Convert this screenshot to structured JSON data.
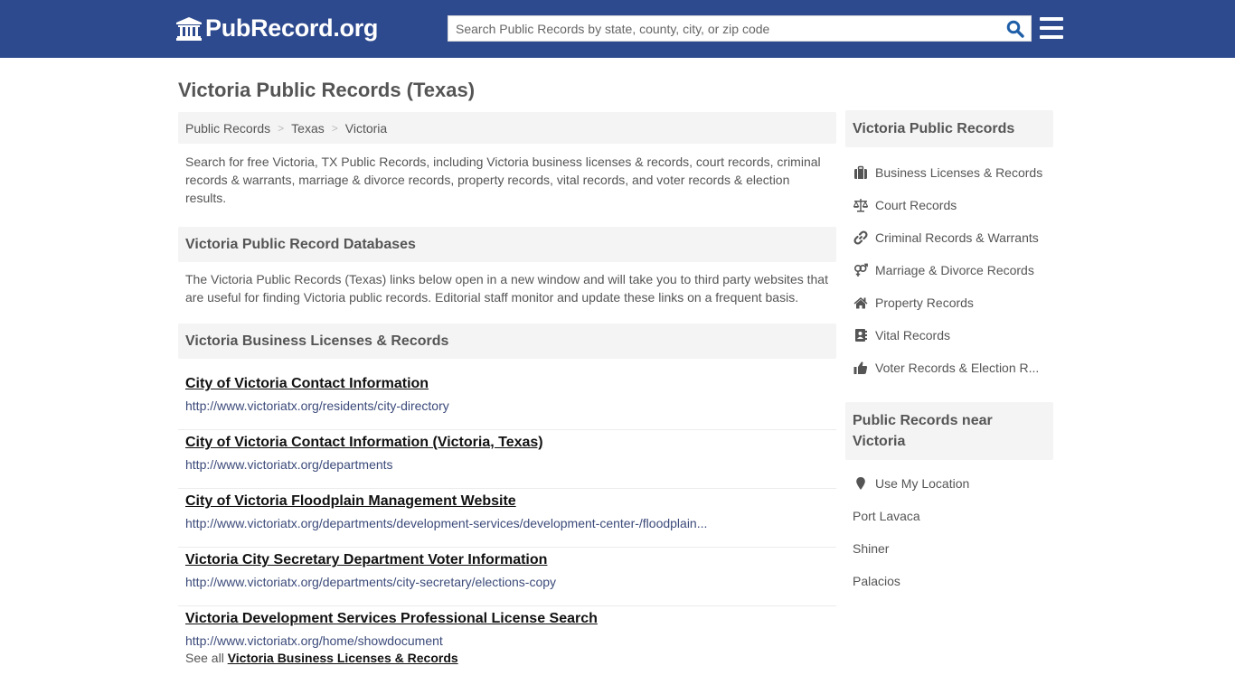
{
  "header": {
    "logo_text": "PubRecord.org",
    "search_placeholder": "Search Public Records by state, county, city, or zip code",
    "search_value": "",
    "colors": {
      "bar": "#2e4a8e",
      "search_icon": "#1f5fa8"
    }
  },
  "page": {
    "title": "Victoria Public Records (Texas)"
  },
  "breadcrumb": [
    {
      "label": "Public Records"
    },
    {
      "label": "Texas"
    },
    {
      "label": "Victoria"
    }
  ],
  "breadcrumb_separator": ">",
  "intro": "Search for free Victoria, TX Public Records, including Victoria business licenses & records, court records, criminal records & warrants, marriage & divorce records, property records, vital records, and voter records & election results.",
  "databases": {
    "heading": "Victoria Public Record Databases",
    "text": "The Victoria Public Records (Texas) links below open in a new window and will take you to third party websites that are useful for finding Victoria public records. Editorial staff monitor and update these links on a frequent basis."
  },
  "business": {
    "heading": "Victoria Business Licenses & Records",
    "links": [
      {
        "title": "City of Victoria Contact Information",
        "url": "http://www.victoriatx.org/residents/city-directory"
      },
      {
        "title": "City of Victoria Contact Information (Victoria, Texas)",
        "url": "http://www.victoriatx.org/departments"
      },
      {
        "title": "City of Victoria Floodplain Management Website",
        "url": "http://www.victoriatx.org/departments/development-services/development-center-/floodplain..."
      },
      {
        "title": "Victoria City Secretary Department Voter Information",
        "url": "http://www.victoriatx.org/departments/city-secretary/elections-copy"
      },
      {
        "title": "Victoria Development Services Professional License Search",
        "url": "http://www.victoriatx.org/home/showdocument"
      }
    ],
    "see_all_prefix": "See all",
    "see_all_link": "Victoria Business Licenses & Records"
  },
  "sidebar": {
    "records_heading": "Victoria Public Records",
    "records": [
      {
        "label": "Business Licenses & Records",
        "icon": "briefcase-icon"
      },
      {
        "label": "Court Records",
        "icon": "balance-scale-icon"
      },
      {
        "label": "Criminal Records & Warrants",
        "icon": "link-icon"
      },
      {
        "label": "Marriage & Divorce Records",
        "icon": "venus-mars-icon"
      },
      {
        "label": "Property Records",
        "icon": "home-icon"
      },
      {
        "label": "Vital Records",
        "icon": "address-book-icon"
      },
      {
        "label": "Voter Records & Election R...",
        "icon": "thumbs-up-icon"
      }
    ],
    "near_heading": "Public Records near Victoria",
    "use_location": {
      "label": "Use My Location",
      "icon": "map-marker-icon"
    },
    "near": [
      {
        "label": "Port Lavaca"
      },
      {
        "label": "Shiner"
      },
      {
        "label": "Palacios"
      }
    ]
  }
}
